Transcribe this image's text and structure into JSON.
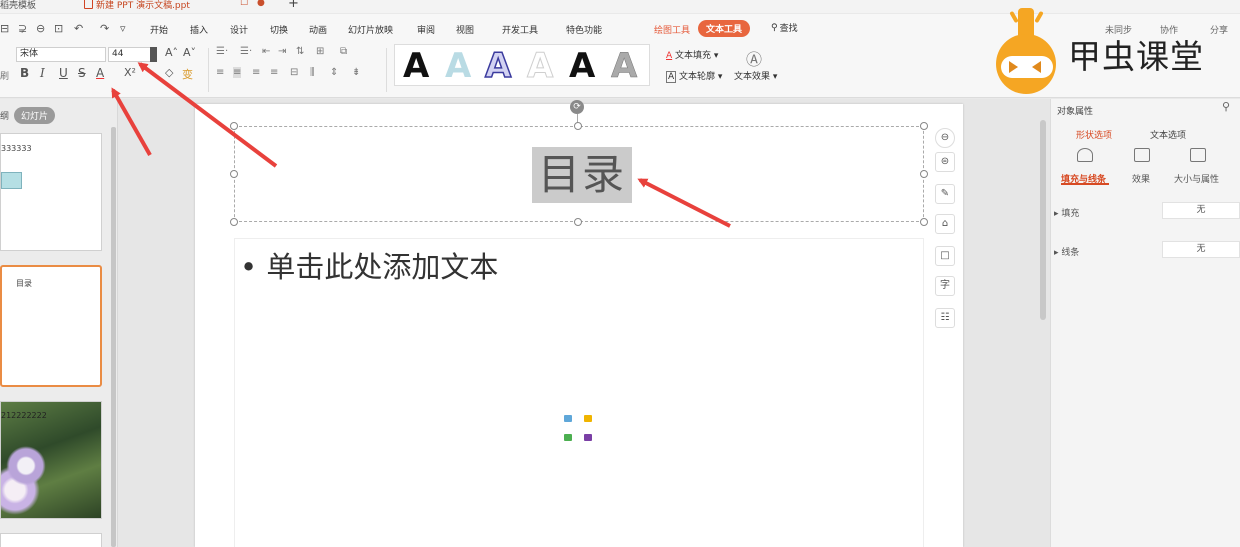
{
  "titlebar": {
    "tabs": [
      {
        "label": "稻壳模板"
      },
      {
        "label": "新建 PPT 演示文稿.ppt"
      }
    ],
    "add_tab": "+"
  },
  "menubar": {
    "items": [
      "开始",
      "插入",
      "设计",
      "切换",
      "动画",
      "幻灯片放映",
      "审阅",
      "视图",
      "开发工具",
      "特色功能"
    ],
    "draw_tool": "绘图工具",
    "text_tool": "文本工具",
    "search": "查找",
    "sync": "未同步",
    "collab": "协作",
    "share": "分享"
  },
  "brand": {
    "name": "甲虫课堂",
    "color": "#f5a623"
  },
  "toolbar": {
    "font_name": "宋体",
    "font_size": "44",
    "format_label": "刷",
    "text_fill": "文本填充",
    "text_outline": "文本轮廓",
    "text_effect": "文本效果",
    "style_glyph": "A"
  },
  "left_pane": {
    "tab_outline": "纲",
    "tab_slides": "幻灯片",
    "slides": [
      {
        "text": "333333"
      },
      {
        "text": "目录"
      },
      {
        "text": "212222222"
      }
    ]
  },
  "slide": {
    "title": "目录",
    "body_placeholder": "单击此处添加文本",
    "bullet": "•",
    "rotate_symbol": "⟳"
  },
  "right_pane": {
    "title": "对象属性",
    "tab_shape": "形状选项",
    "tab_text": "文本选项",
    "sub_fill_line": "填充与线条",
    "sub_effect": "效果",
    "sub_size": "大小与属性",
    "rows": [
      {
        "label": "填充",
        "value": "无"
      },
      {
        "label": "线条",
        "value": "无"
      }
    ]
  },
  "colors": {
    "accent": "#e8663e",
    "active_text": "#d74a23",
    "arrow": "#e8413c"
  }
}
